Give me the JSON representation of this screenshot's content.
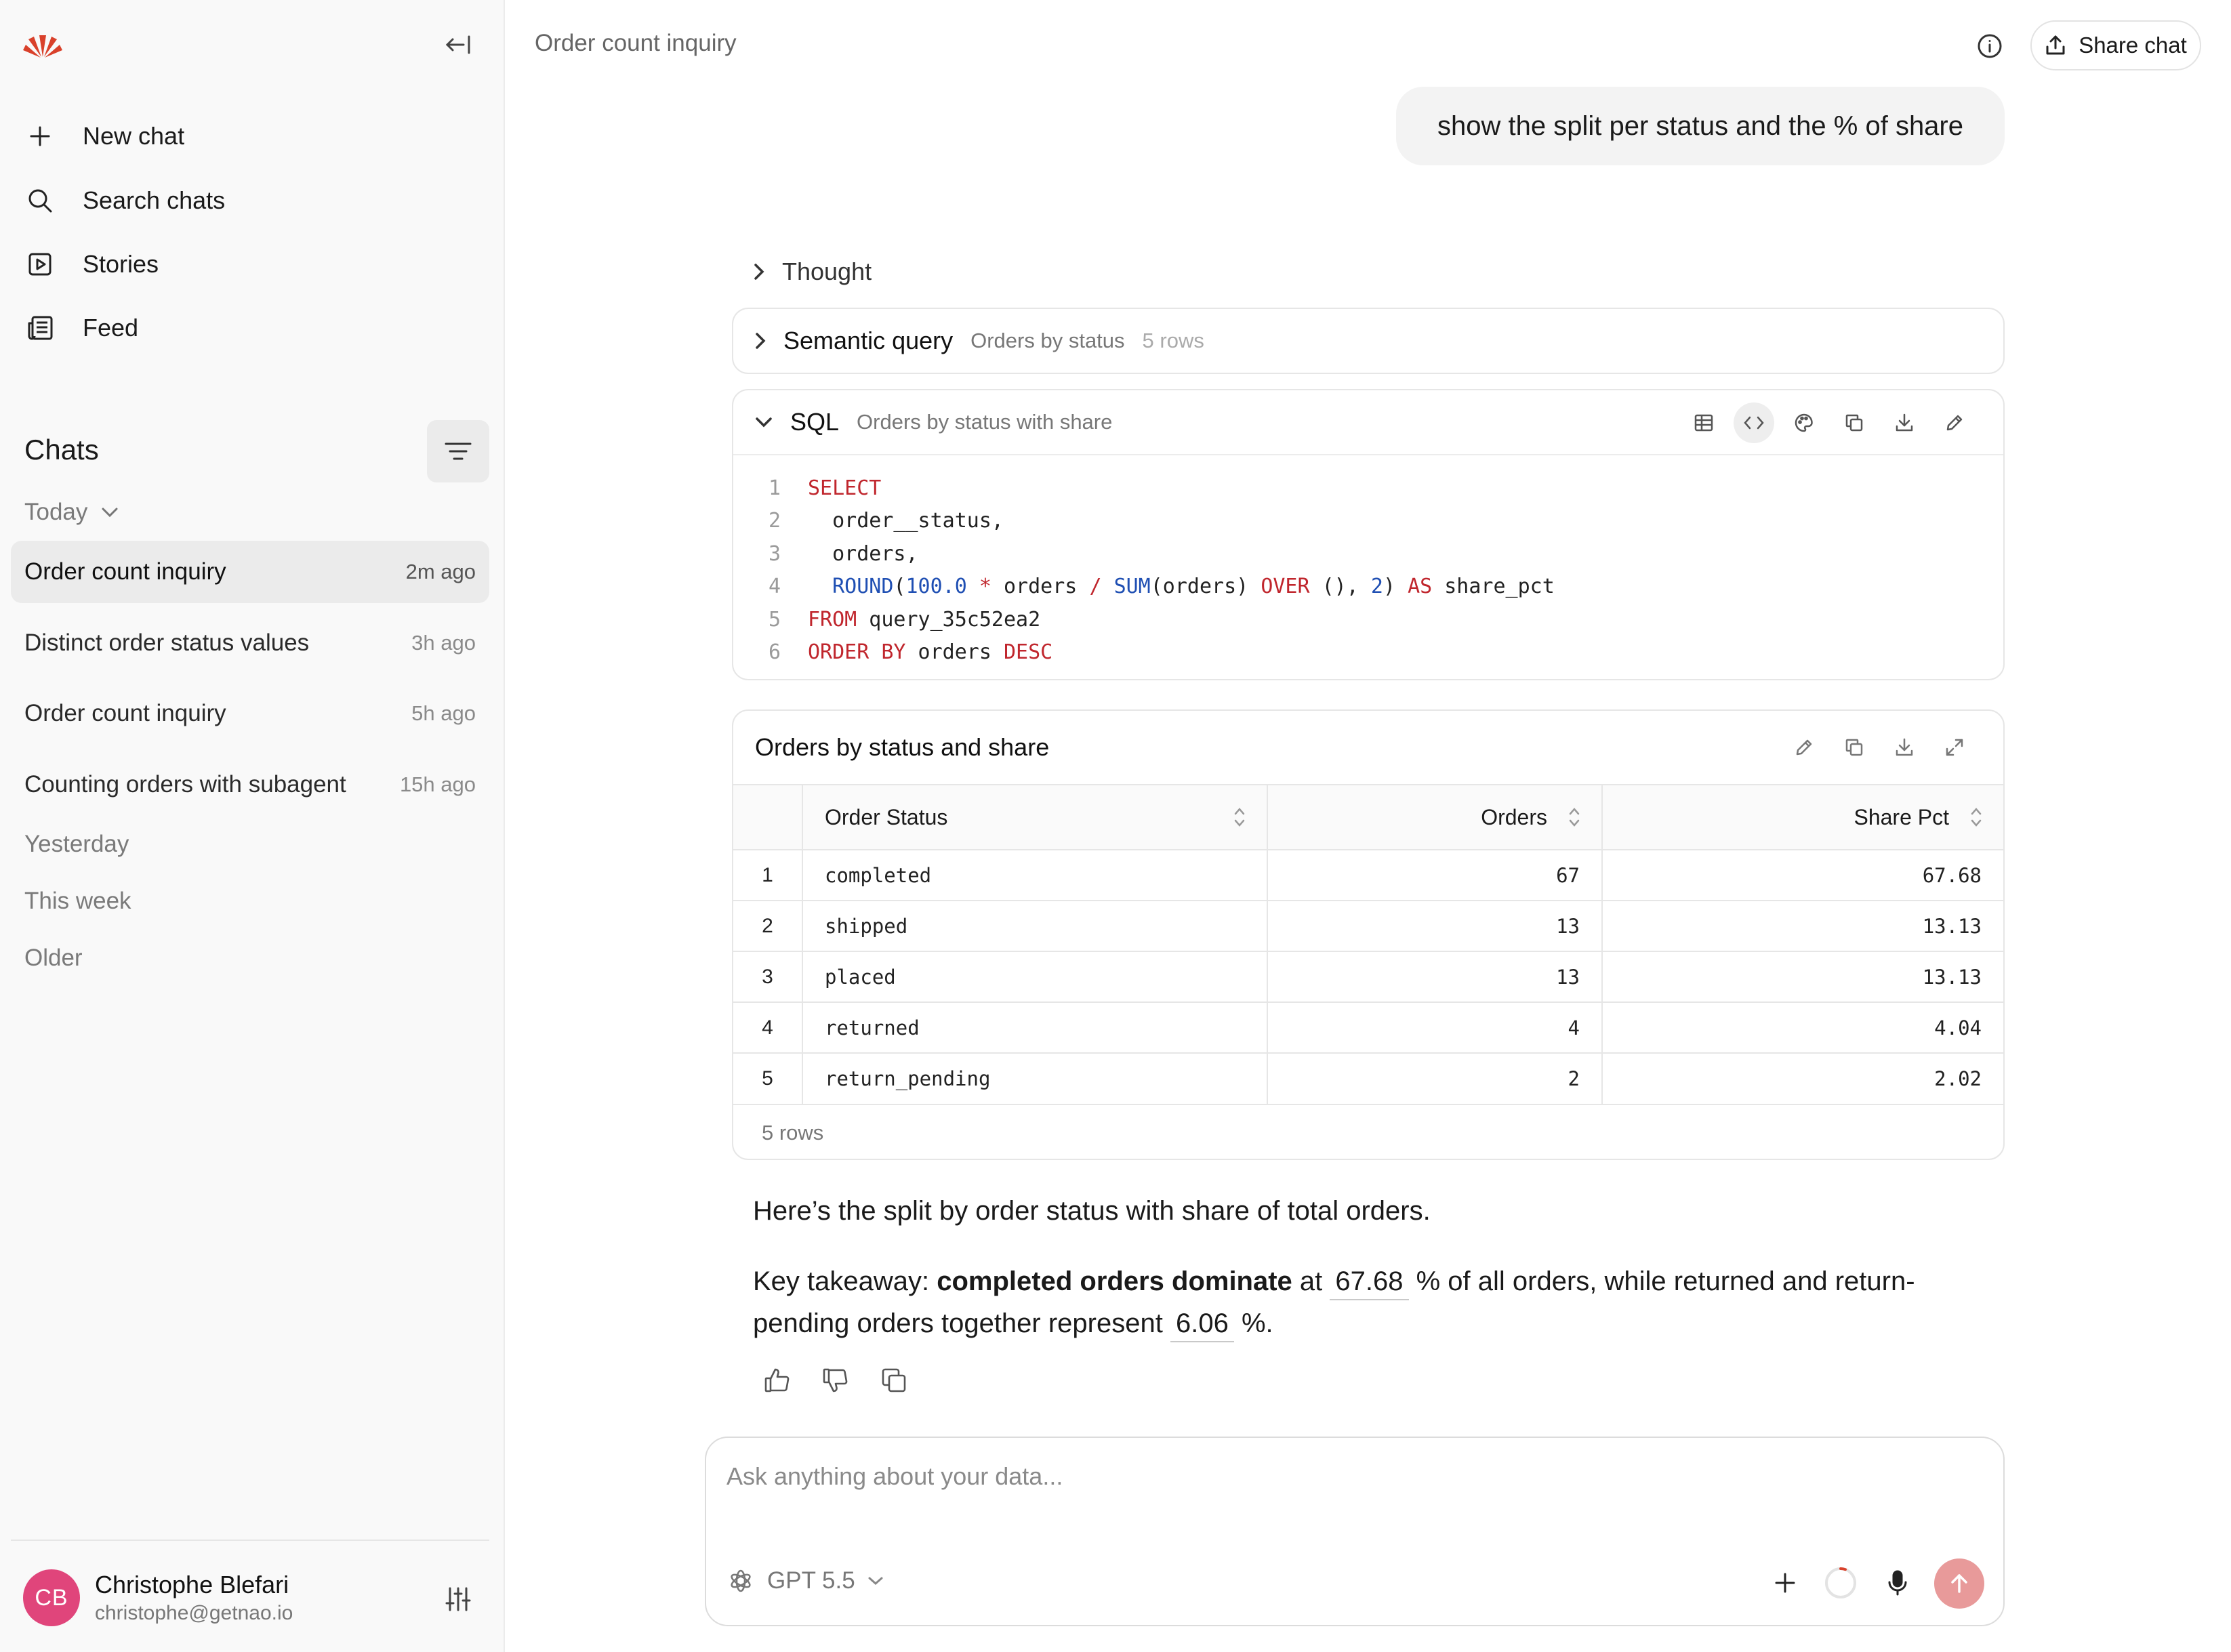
{
  "sidebar": {
    "nav": [
      {
        "label": "New chat",
        "icon": "plus-icon"
      },
      {
        "label": "Search chats",
        "icon": "search-icon"
      },
      {
        "label": "Stories",
        "icon": "play-square-icon"
      },
      {
        "label": "Feed",
        "icon": "newspaper-icon"
      }
    ],
    "chats_title": "Chats",
    "groups": {
      "today": "Today",
      "yesterday": "Yesterday",
      "this_week": "This week",
      "older": "Older"
    },
    "chats": [
      {
        "title": "Order count inquiry",
        "time": "2m ago",
        "active": true
      },
      {
        "title": "Distinct order status values",
        "time": "3h ago"
      },
      {
        "title": "Order count inquiry",
        "time": "5h ago"
      },
      {
        "title": "Counting orders with subagent",
        "time": "15h ago"
      }
    ],
    "user": {
      "initials": "CB",
      "name": "Christophe Blefari",
      "email": "christophe@getnao.io",
      "avatar_color": "#e0457b"
    }
  },
  "header": {
    "title": "Order count inquiry",
    "share_label": "Share chat"
  },
  "conversation": {
    "user_message": "show the split per status and the % of share",
    "thought_label": "Thought",
    "semantic_query": {
      "label": "Semantic query",
      "subtitle": "Orders by status",
      "meta": "5 rows"
    },
    "sql": {
      "label": "SQL",
      "subtitle": "Orders by status with share",
      "line_numbers": [
        "1",
        "2",
        "3",
        "4",
        "5",
        "6"
      ],
      "tokens": {
        "select": "SELECT",
        "col1": "  order__status,",
        "col2": "  orders,",
        "round": "ROUND",
        "paren_open": "(",
        "hundred": "100.0",
        "star": " * ",
        "orders_a": "orders ",
        "slash": "/ ",
        "sum": "SUM",
        "sum_args": "(orders) ",
        "over": "OVER",
        "over_args": " (), ",
        "two": "2",
        "close": ") ",
        "as": "AS",
        "alias": " share_pct",
        "from": "FROM",
        "table": " query_35c52ea2",
        "order_by": "ORDER BY",
        "orders_b": " orders ",
        "desc": "DESC"
      }
    },
    "table": {
      "title": "Orders by status and share",
      "columns": [
        "Order Status",
        "Orders",
        "Share Pct"
      ],
      "rows": [
        {
          "idx": "1",
          "status": "completed",
          "orders": "67",
          "share": "67.68"
        },
        {
          "idx": "2",
          "status": "shipped",
          "orders": "13",
          "share": "13.13"
        },
        {
          "idx": "3",
          "status": "placed",
          "orders": "13",
          "share": "13.13"
        },
        {
          "idx": "4",
          "status": "returned",
          "orders": "4",
          "share": "4.04"
        },
        {
          "idx": "5",
          "status": "return_pending",
          "orders": "2",
          "share": "2.02"
        }
      ],
      "footer": "5 rows"
    },
    "answer": {
      "intro": "Here’s the split by order status with share of total orders.",
      "takeaway_prefix": "Key takeaway: ",
      "takeaway_bold": "completed orders dominate",
      "takeaway_mid1": " at ",
      "value_completed": "67.68",
      "takeaway_mid2": " % of all orders, while returned and return-pending orders together represent ",
      "value_returns": "6.06",
      "takeaway_end": " %."
    }
  },
  "composer": {
    "placeholder": "Ask anything about your data...",
    "model": "GPT 5.5"
  },
  "colors": {
    "accent": "#e89a9a",
    "keyword": "#c0262d",
    "function": "#1f4fb3"
  }
}
